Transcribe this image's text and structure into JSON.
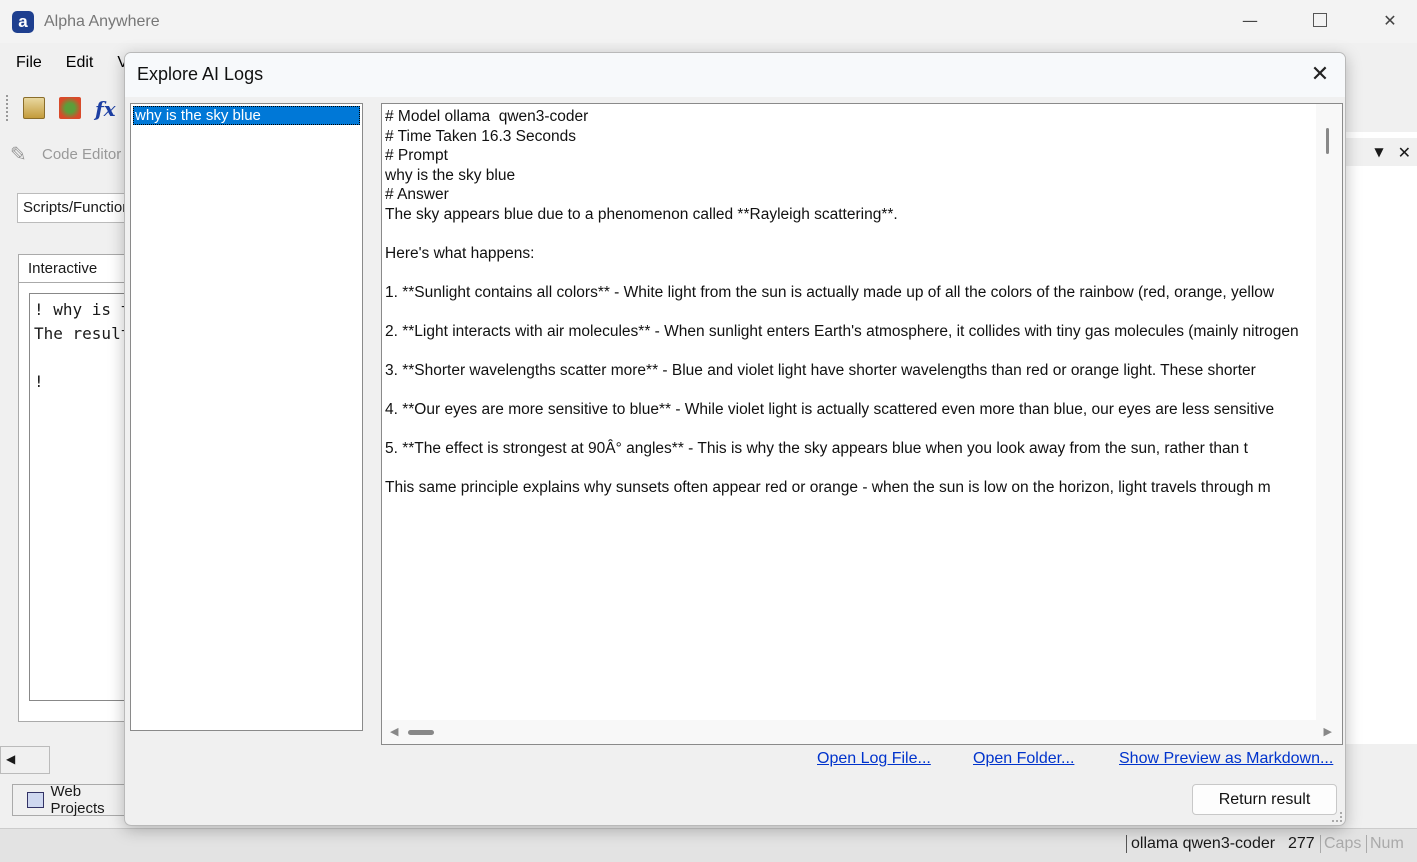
{
  "app": {
    "title": "Alpha Anywhere",
    "logo_letter": "a",
    "minimize": "—",
    "close": "✕"
  },
  "menu": [
    "File",
    "Edit",
    "V"
  ],
  "code_editor": {
    "label": "Code Editor",
    "scripts_dropdown": "Scripts/Functions",
    "interactive_tab": "Interactive",
    "interactive_text": "! why is the sky blue\nThe result\n\n!"
  },
  "web_projects_tab": "Web Projects",
  "right_pane": {
    "dropdown_icon": "▼",
    "close_icon": "✕"
  },
  "statusbar": {
    "model": "ollama  qwen3-coder",
    "count": "277",
    "caps": "Caps",
    "num": "Num"
  },
  "dialog": {
    "title": "Explore AI Logs",
    "close": "✕",
    "log_items": [
      "why is the sky blue"
    ],
    "log_text": "# Model ollama  qwen3-coder\n# Time Taken 16.3 Seconds\n# Prompt\nwhy is the sky blue\n# Answer\nThe sky appears blue due to a phenomenon called **Rayleigh scattering**.\n\nHere's what happens:\n\n1. **Sunlight contains all colors** - White light from the sun is actually made up of all the colors of the rainbow (red, orange, yellow\n\n2. **Light interacts with air molecules** - When sunlight enters Earth's atmosphere, it collides with tiny gas molecules (mainly nitrogen\n\n3. **Shorter wavelengths scatter more** - Blue and violet light have shorter wavelengths than red or orange light. These shorter\n\n4. **Our eyes are more sensitive to blue** - While violet light is actually scattered even more than blue, our eyes are less sensitive\n\n5. **The effect is strongest at 90Â° angles** - This is why the sky appears blue when you look away from the sun, rather than t\n\nThis same principle explains why sunsets often appear red or orange - when the sun is low on the horizon, light travels through m",
    "links": {
      "open_log": "Open Log File...",
      "open_folder": "Open Folder...",
      "preview": "Show Preview as Markdown..."
    },
    "return_button": "Return result"
  }
}
